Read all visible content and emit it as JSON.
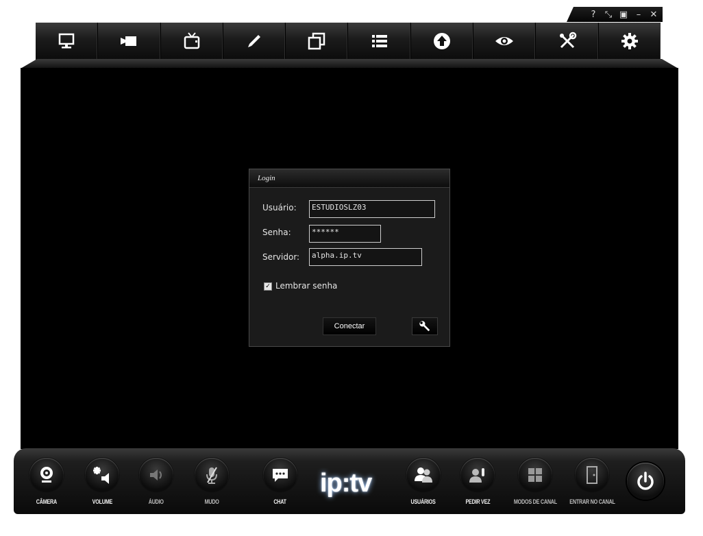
{
  "window_controls": [
    "?",
    "⤡",
    "▣",
    "–",
    "✕"
  ],
  "top_toolbar": [
    {
      "name": "monitor"
    },
    {
      "name": "video-camera"
    },
    {
      "name": "tv"
    },
    {
      "name": "pencil"
    },
    {
      "name": "windows"
    },
    {
      "name": "list"
    },
    {
      "name": "upload"
    },
    {
      "name": "eye"
    },
    {
      "name": "tools"
    },
    {
      "name": "gear"
    }
  ],
  "login": {
    "title": "Login",
    "usuario_label": "Usuário:",
    "usuario_value": "ESTUDIOSLZ03",
    "senha_label": "Senha:",
    "senha_value": "******",
    "servidor_label": "Servidor:",
    "servidor_value": "alpha.ip.tv",
    "remember_label": "Lembrar senha",
    "remember_checked": true,
    "connect_label": "Conectar"
  },
  "bottom_bar": {
    "items": [
      {
        "label": "CÂMERA",
        "icon": "webcam-icon"
      },
      {
        "label": "VOLUME",
        "icon": "volume-icon"
      },
      {
        "label": "ÁUDIO",
        "icon": "audio-icon"
      },
      {
        "label": "MUDO",
        "icon": "mic-muted-icon"
      },
      {
        "label": "CHAT",
        "icon": "chat-icon"
      },
      {
        "label": "USUÁRIOS",
        "icon": "users-icon"
      },
      {
        "label": "PEDIR VEZ",
        "icon": "raise-hand-icon"
      },
      {
        "label": "MODOS DE CANAL",
        "icon": "grid-icon"
      },
      {
        "label": "ENTRAR NO CANAL",
        "icon": "door-icon"
      }
    ],
    "logo_text": "ip:tv"
  }
}
